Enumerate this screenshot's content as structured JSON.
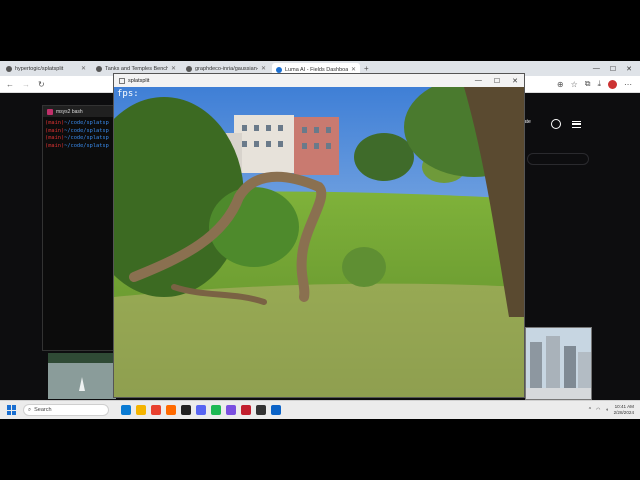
{
  "browser": {
    "tabs": [
      {
        "label": "hypertogic/splatsplit",
        "active": false
      },
      {
        "label": "Tanks and Temples Benchmark",
        "active": false
      },
      {
        "label": "graphdeco-inria/gaussian-splatting",
        "active": false
      },
      {
        "label": "Luma AI - Fields Dashboard",
        "active": true
      }
    ],
    "new_tab": "+",
    "window_controls": [
      "—",
      "☐",
      "✕"
    ]
  },
  "page": {
    "create_label": "eate"
  },
  "terminal": {
    "title": "msys2 bash",
    "lines": [
      {
        "branch": "(main)",
        "path": "~/code/splatsp"
      },
      {
        "branch": "(main)",
        "path": "~/code/splatsp"
      },
      {
        "branch": "(main)",
        "path": "~/code/splatsp"
      },
      {
        "branch": "(main)",
        "path": "~/code/splatsp"
      }
    ]
  },
  "viewer": {
    "title": "splatsplit",
    "fps_label": "fps:",
    "controls": [
      "—",
      "☐",
      "✕"
    ]
  },
  "taskbar": {
    "search_placeholder": "Search",
    "time": "10:41 AM",
    "date": "2/28/2024",
    "app_colors": [
      "#0a7bd3",
      "#f4b400",
      "#e8412f",
      "#ff6a00",
      "#222222",
      "#5865f2",
      "#1db954",
      "#7a4fe0",
      "#c21f2e",
      "#333333",
      "#0b63c7"
    ]
  },
  "colors": {
    "terminal_branch": "#dd3333",
    "terminal_path": "#3a8df0",
    "accent": "#1a6fd1"
  }
}
